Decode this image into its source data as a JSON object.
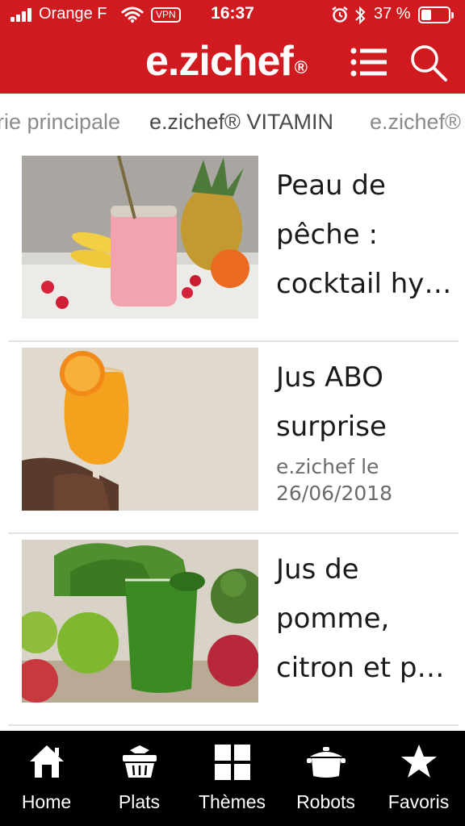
{
  "status_bar": {
    "carrier": "Orange F",
    "vpn": "VPN",
    "time": "16:37",
    "battery": "37 %",
    "battery_level": 0.37
  },
  "header": {
    "logo": "e.zichef",
    "logo_mark": "®",
    "menu_icon": "list-menu-icon",
    "search_icon": "search-icon",
    "background_color": "#d01a1f"
  },
  "tabs": [
    {
      "label": "rie principale"
    },
    {
      "label": "e.zichef® VITAMIN"
    },
    {
      "label": "e.zichef®"
    }
  ],
  "articles": [
    {
      "title": "Peau de pêche : cocktail hy…",
      "meta": ""
    },
    {
      "title": "Jus ABO surprise",
      "meta": "e.zichef le 26/06/2018"
    },
    {
      "title": "Jus de pomme, citron et p…",
      "meta": ""
    }
  ],
  "bottom_nav": [
    {
      "label": "Home",
      "icon": "home-icon"
    },
    {
      "label": "Plats",
      "icon": "basket-icon"
    },
    {
      "label": "Thèmes",
      "icon": "grid-icon"
    },
    {
      "label": "Robots",
      "icon": "pot-icon"
    },
    {
      "label": "Favoris",
      "icon": "star-icon"
    }
  ]
}
